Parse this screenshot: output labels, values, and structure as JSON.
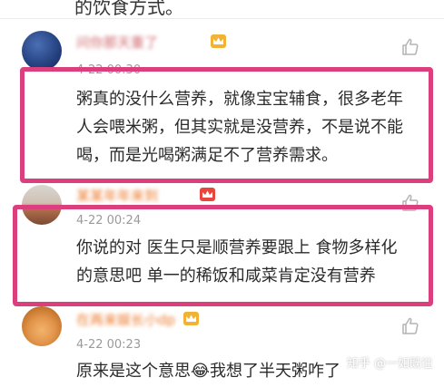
{
  "top_partial": {
    "text": "的饮食方式。"
  },
  "comments": [
    {
      "username": "问你那天重了",
      "time": "4-22 00:30",
      "lines": [
        "粥真的没什么营养，就像宝宝辅食，很多老年",
        "人会喂米粥，但其实就是没营养，不是说不能",
        "喝，而是光喝粥满足不了营养需求。"
      ]
    },
    {
      "username": "某某年年来到",
      "time": "4-22 00:24",
      "lines": [
        "你说的对 医生只是顺营养要跟上 食物多样化",
        "的意思吧 单一的稀饭和咸菜肯定没有营养"
      ]
    },
    {
      "username": "在再来娱长小dp",
      "time": "4-22 00:23",
      "lines": [
        "原来是这个意思😂我想了半天粥咋了"
      ]
    }
  ],
  "watermark": "知乎 @一如既往",
  "colors": {
    "highlight_border": "#dc3f7e",
    "vip_badge": "#f2b233",
    "username_orange": "#ec7a2c",
    "timestamp": "#9a9a9a"
  },
  "icons": [
    "vip-crown-icon",
    "thumbs-up-icon"
  ]
}
